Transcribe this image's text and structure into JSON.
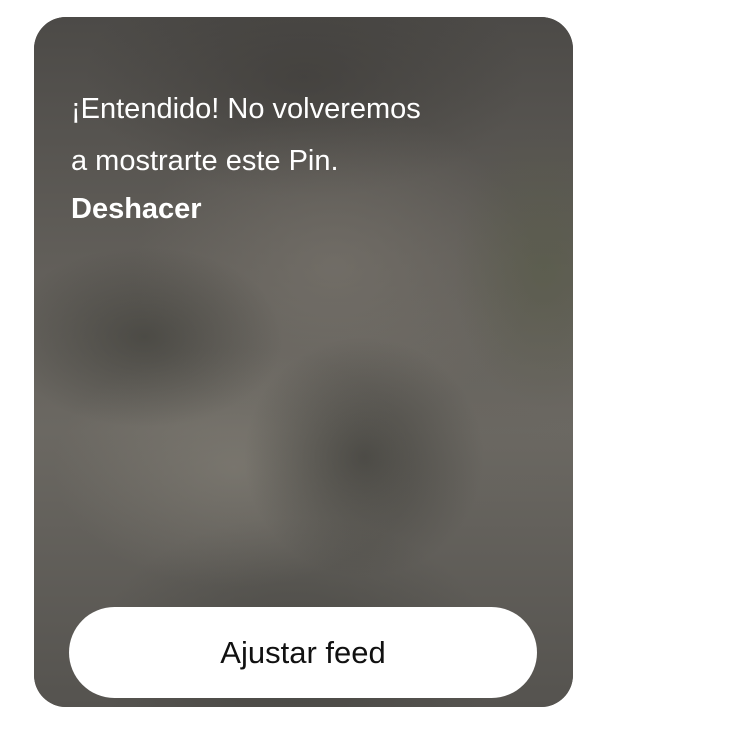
{
  "card": {
    "message": "¡Entendido! No volveremos\na mostrarte este Pin.",
    "undo_label": "Deshacer",
    "adjust_label": "Ajustar feed"
  },
  "colors": {
    "page_background": "#ffffff",
    "card_text": "#ffffff",
    "button_background": "#ffffff",
    "button_text": "#111111"
  }
}
